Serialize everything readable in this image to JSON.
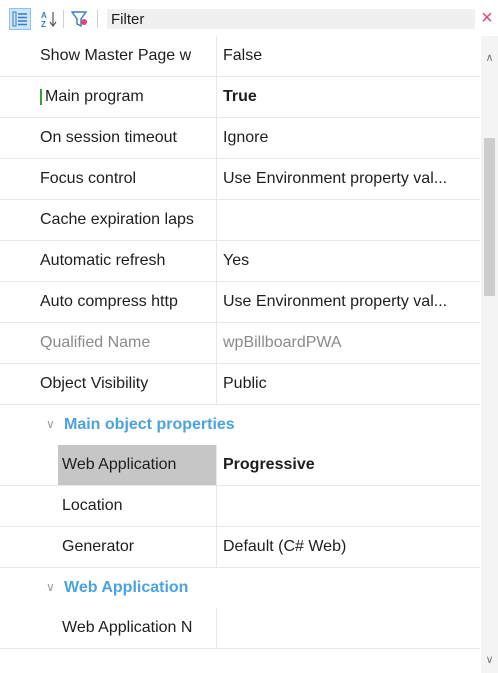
{
  "toolbar": {
    "filter_label": "Filter",
    "clear_icon": "×",
    "categorized_icon": "categorized-icon",
    "alphabetical_icon": "sort-az-icon",
    "funnel_icon": "filter-funnel-icon"
  },
  "properties": [
    {
      "name": "Show Master Page w",
      "value": "False"
    },
    {
      "name": "Main program",
      "value": "True",
      "bold": true,
      "modified": true
    },
    {
      "name": "On session timeout",
      "value": "Ignore"
    },
    {
      "name": "Focus control",
      "value": "Use Environment property val..."
    },
    {
      "name": "Cache expiration laps",
      "value": ""
    },
    {
      "name": "Automatic refresh",
      "value": "Yes"
    },
    {
      "name": "Auto compress http",
      "value": "Use Environment property val..."
    },
    {
      "name": "Qualified Name",
      "value": "wpBillboardPWA",
      "disabled": true
    },
    {
      "name": "Object Visibility",
      "value": "Public"
    }
  ],
  "categories": [
    {
      "title": "Main object properties",
      "properties": [
        {
          "name": "Web Application",
          "value": "Progressive",
          "bold": true,
          "selected": true
        },
        {
          "name": "Location",
          "value": ""
        },
        {
          "name": "Generator",
          "value": "Default (C# Web)"
        }
      ]
    },
    {
      "title": "Web Application",
      "properties": [
        {
          "name": "Web Application N",
          "value": ""
        }
      ]
    }
  ],
  "colors": {
    "category_title": "#4aa3df",
    "selected_name_bg": "#c6c6c6",
    "clear_button": "#e0457b",
    "modified_marker": "#3c9a3c"
  }
}
